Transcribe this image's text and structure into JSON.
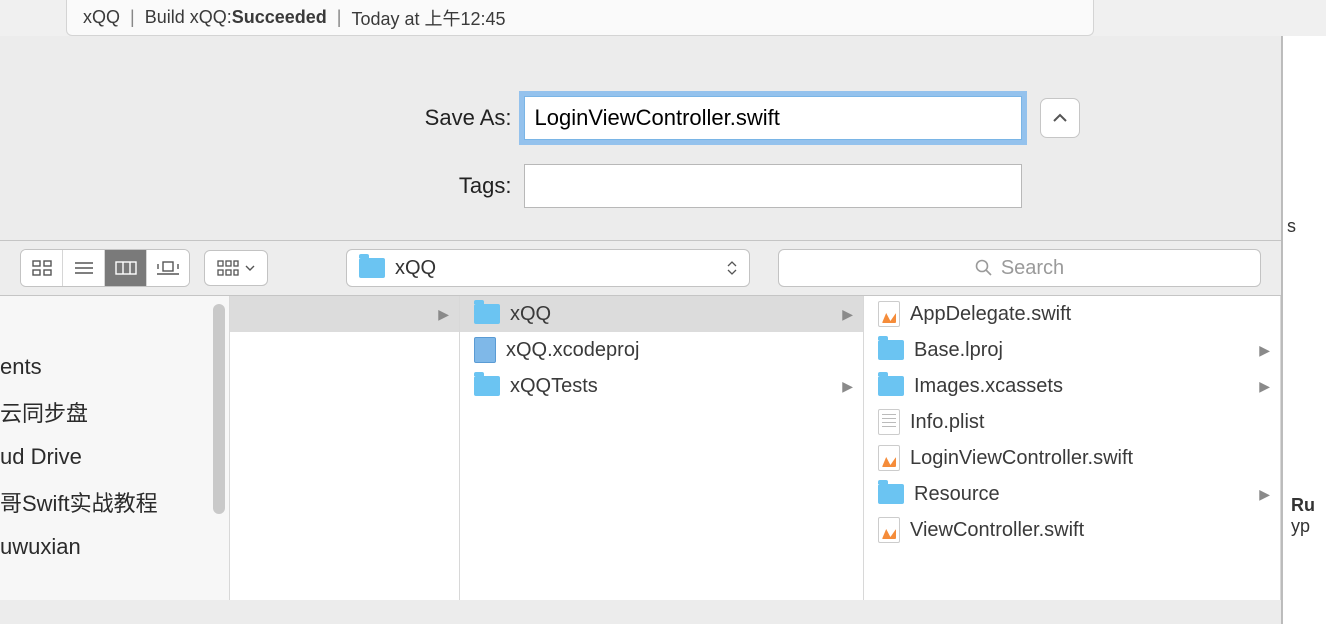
{
  "status": {
    "project": "xQQ",
    "build_prefix": "Build xQQ: ",
    "build_status": "Succeeded",
    "time": "Today at 上午12:45"
  },
  "form": {
    "save_as_label": "Save As:",
    "save_as_value": "LoginViewController.swift",
    "tags_label": "Tags:",
    "tags_value": ""
  },
  "toolbar": {
    "path": "xQQ",
    "search_placeholder": "Search"
  },
  "sidebar": {
    "items": [
      "ents",
      "云同步盘",
      "ud Drive",
      "哥Swift实战教程",
      "uwuxian"
    ]
  },
  "col2": {
    "items": [
      {
        "name": "xQQ",
        "type": "folder",
        "selected": true,
        "has_children": true
      },
      {
        "name": "xQQ.xcodeproj",
        "type": "proj",
        "selected": false,
        "has_children": false
      },
      {
        "name": "xQQTests",
        "type": "folder",
        "selected": false,
        "has_children": true
      }
    ]
  },
  "col3": {
    "items": [
      {
        "name": "AppDelegate.swift",
        "type": "swift",
        "has_children": false
      },
      {
        "name": "Base.lproj",
        "type": "folder",
        "has_children": true
      },
      {
        "name": "Images.xcassets",
        "type": "folder",
        "has_children": true
      },
      {
        "name": "Info.plist",
        "type": "plist",
        "has_children": false
      },
      {
        "name": "LoginViewController.swift",
        "type": "swift",
        "has_children": false
      },
      {
        "name": "Resource",
        "type": "folder",
        "has_children": true
      },
      {
        "name": "ViewController.swift",
        "type": "swift",
        "has_children": false
      }
    ]
  },
  "right_panel": {
    "items": [
      "s",
      "Ru",
      "yp"
    ]
  }
}
